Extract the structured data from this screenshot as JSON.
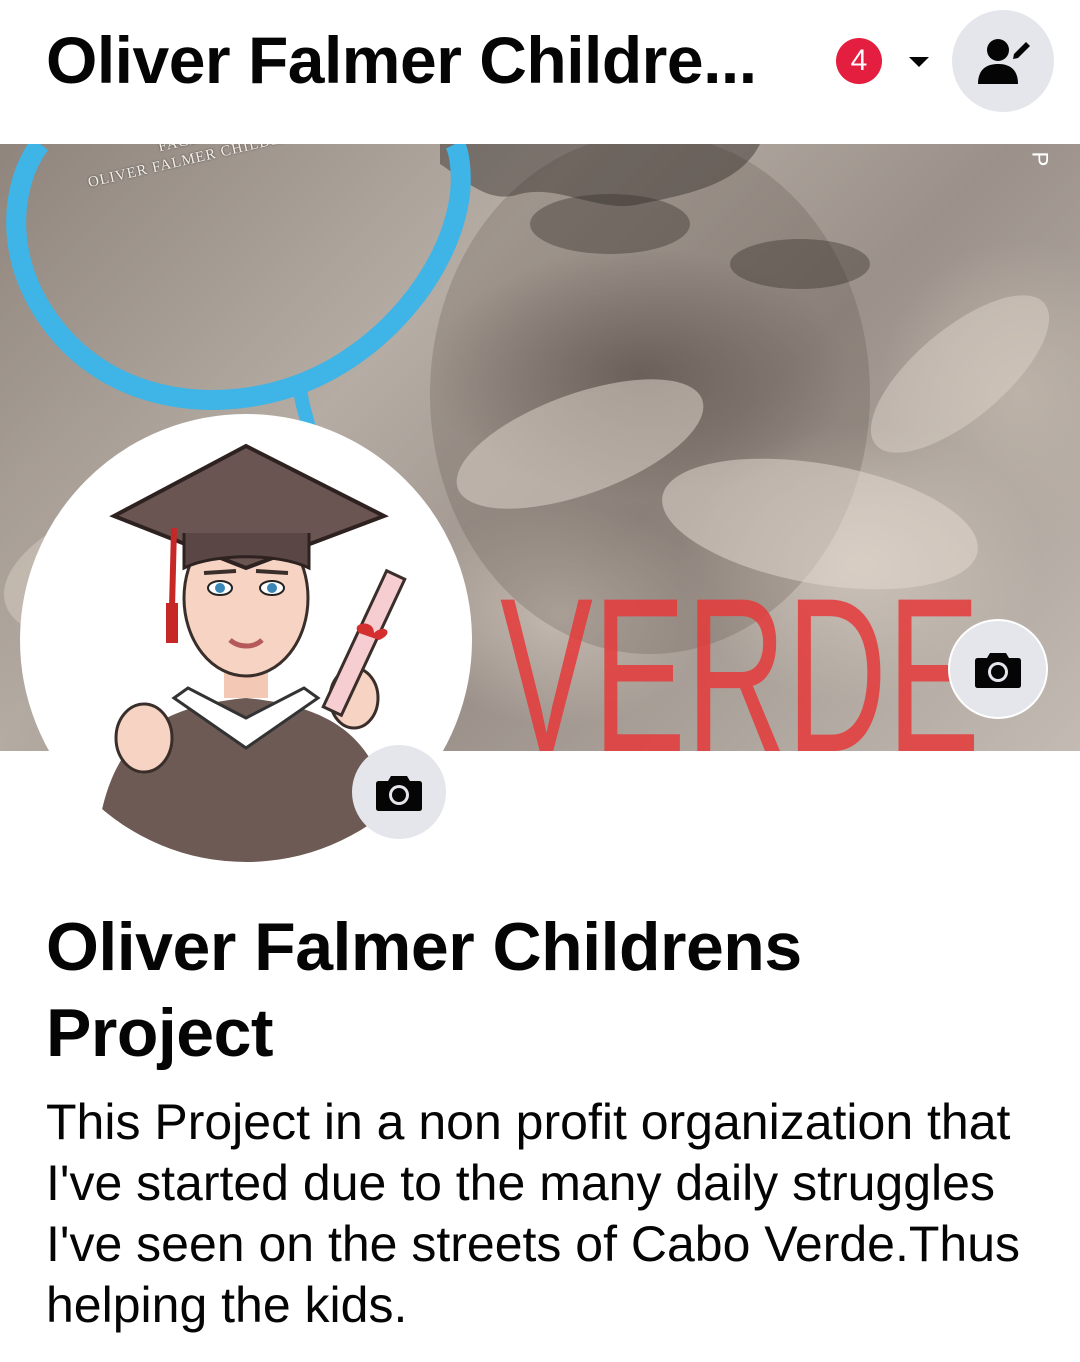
{
  "header": {
    "title": "Oliver Falmer Childre...",
    "notification_count": "4",
    "dropdown_icon": "caret-down-icon",
    "switch_profile_icon": "person-edit-icon"
  },
  "cover": {
    "caption_line1": "Facebook Page",
    "caption_line2": "Oliver Falmer Children's Proje",
    "corner_text": "P",
    "verde_text": "VERDE",
    "camera_icon": "camera-icon"
  },
  "avatar": {
    "camera_icon": "camera-icon"
  },
  "page": {
    "name": "Oliver Falmer Childrens Project",
    "description": "This Project in a non profit organization that I've started due to the many daily struggles I've seen on the streets of Cabo Verde.Thus helping the kids."
  },
  "colors": {
    "badge": "#e41e3f",
    "icon_bg": "#e4e6eb",
    "ring": "#3fb4e6"
  }
}
